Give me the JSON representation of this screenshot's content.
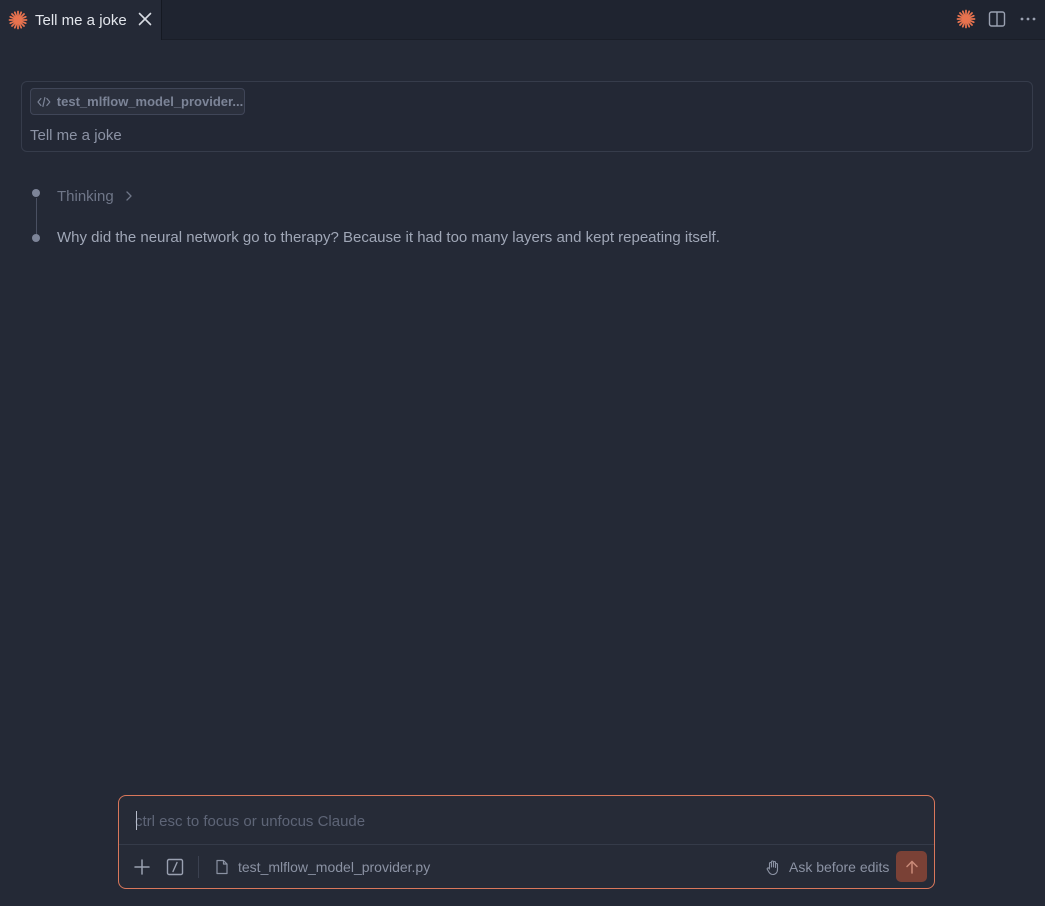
{
  "tab": {
    "title": "Tell me a joke",
    "icon": "claude-spark-icon",
    "accent": "#e8734f"
  },
  "tabbar_actions": [
    {
      "name": "claude-spark-icon"
    },
    {
      "name": "split-editor-icon"
    },
    {
      "name": "more-actions-icon"
    }
  ],
  "user_message": {
    "attachment_label": "test_mlflow_model_provider....",
    "text": "Tell me a joke"
  },
  "thinking": {
    "label": "Thinking"
  },
  "assistant": {
    "text": "Why did the neural network go to therapy? Because it had too many layers and kept repeating itself."
  },
  "composer": {
    "placeholder": "ctrl esc to focus or unfocus Claude",
    "value": "",
    "attached_file": "test_mlflow_model_provider.py",
    "mode_label": "Ask before edits",
    "border_color": "#d9775b",
    "send_color": "#7a4136"
  }
}
